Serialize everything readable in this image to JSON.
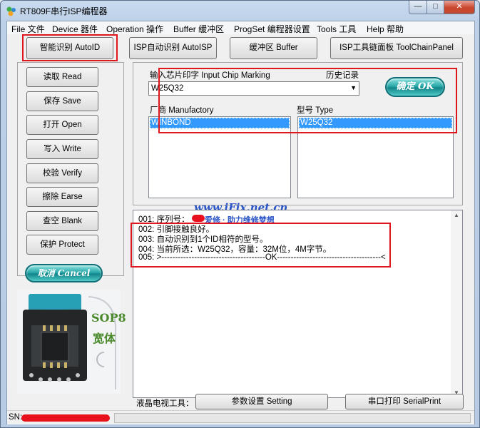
{
  "window": {
    "title": "RT809F串行ISP编程器",
    "min_glyph": "—",
    "max_glyph": "□",
    "close_glyph": "✕"
  },
  "menu": [
    "File 文件",
    "Device 器件",
    "Operation 操作",
    "Buffer 缓冲区",
    "ProgSet 编程器设置",
    "Tools 工具",
    "Help 帮助"
  ],
  "toolbar": {
    "autoid": "智能识别 AutoID",
    "autoisp": "ISP自动识别 AutoISP",
    "buffer": "缓冲区 Buffer",
    "toolchain": "ISP工具链面板  ToolChainPanel"
  },
  "sidebar": {
    "read": "读取 Read",
    "save": "保存 Save",
    "open": "打开 Open",
    "write": "写入 Write",
    "verify": "校验 Verify",
    "erase": "擦除 Earse",
    "blank": "查空 Blank",
    "protect": "保护 Protect",
    "cancel": "取消 Cancel"
  },
  "chip": {
    "input_label": "输入芯片印字 Input Chip Marking",
    "history_label": "历史记录",
    "input_value": "W25Q32",
    "ok_label": "确定 OK",
    "manufactory_label": "厂商 Manufactory",
    "type_label": "型号 Type",
    "manufacturers": [
      "WINBOND"
    ],
    "types": [
      "W25Q32"
    ]
  },
  "socket": {
    "label_line1": "SOP8",
    "label_line2": "宽体"
  },
  "watermark": {
    "url": "www.iFix.net.cn",
    "tagline": "爱修 · 助力维修梦想"
  },
  "log": [
    "001: 序列号：",
    "002: 引脚接触良好。",
    "003: 自动识别到1个ID相符的型号。",
    "004: 当前所选：W25Q32，容量：32M位，4M字节。",
    "005: >--------------------------------------OK--------------------------------------<"
  ],
  "bottom": {
    "lcd_label": "液晶电视工具：",
    "setting": "参数设置 Setting",
    "serial": "串口打印 SerialPrint"
  },
  "status": {
    "sn_label": "SN:"
  }
}
